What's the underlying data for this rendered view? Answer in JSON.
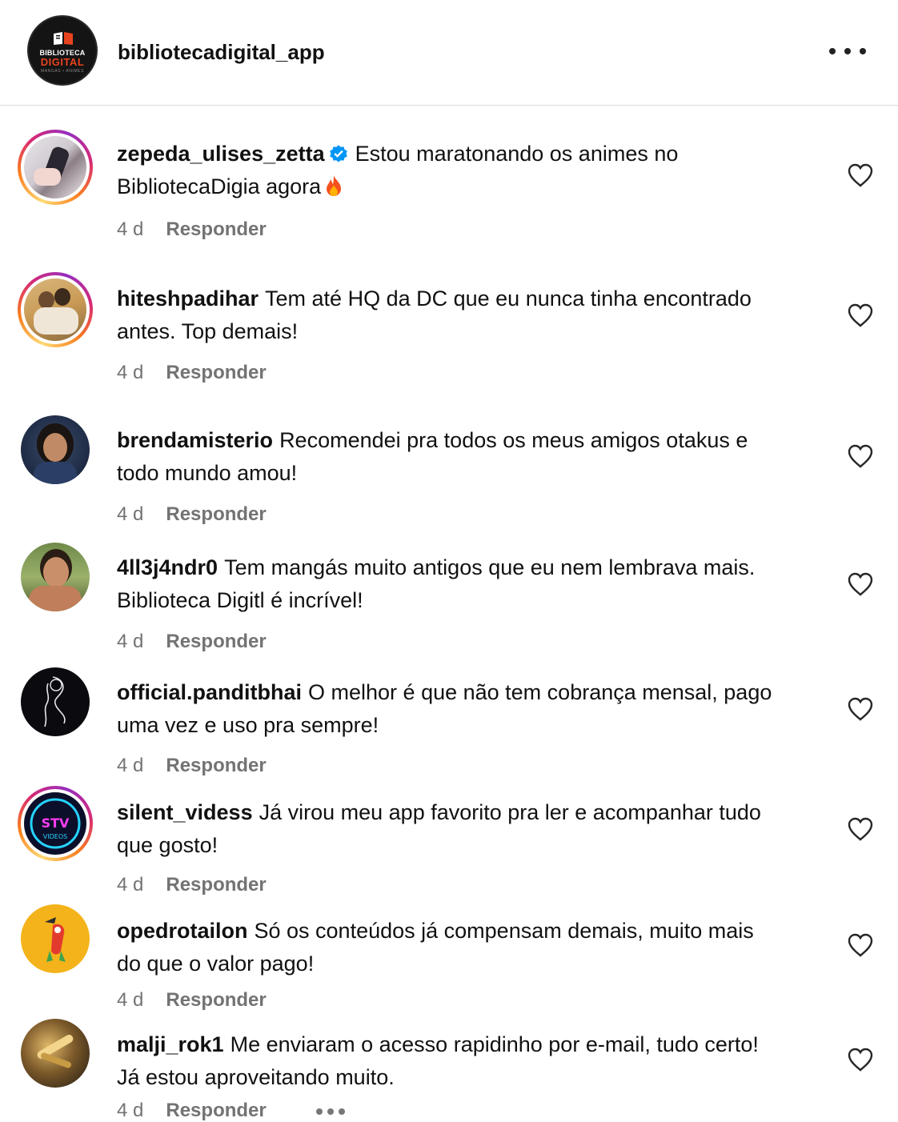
{
  "header": {
    "account_name": "bibliotecadigital_app",
    "logo_line1": "BIBLIOTECA",
    "logo_line2": "DIGITAL",
    "logo_line3": "MANGAS • ANIMES",
    "more_icon": "more-horizontal-icon"
  },
  "comments": [
    {
      "user": "zepeda_ulises_zetta",
      "verified": true,
      "text": "Estou maratonando os animes no BibliotecaDigia agora",
      "emoji": "fire-icon",
      "time": "4 d",
      "reply": "Responder",
      "story_ring": true
    },
    {
      "user": "hiteshpadihar",
      "text": "Tem até HQ da DC que eu nunca tinha encontrado antes. Top demais!",
      "time": "4 d",
      "reply": "Responder",
      "story_ring": true
    },
    {
      "user": "brendamisterio",
      "text": "Recomendei pra todos os meus amigos otakus e todo mundo amou!",
      "time": "4 d",
      "reply": "Responder",
      "story_ring": false
    },
    {
      "user": "4ll3j4ndr0",
      "text": "Tem mangás muito antigos que eu nem lembrava mais. Biblioteca Digitl é incrível!",
      "time": "4 d",
      "reply": "Responder",
      "story_ring": false
    },
    {
      "user": "official.panditbhai",
      "text": "O melhor é que não tem cobrança mensal, pago uma vez e uso pra sempre!",
      "time": "4 d",
      "reply": "Responder",
      "story_ring": false
    },
    {
      "user": "silent_videss",
      "text": "Já virou meu app favorito pra ler e acompanhar tudo que gosto!",
      "time": "4 d",
      "reply": "Responder",
      "story_ring": true
    },
    {
      "user": "opedrotailon",
      "text": "Só os conteúdos já compensam demais, muito mais do que o valor pago!",
      "time": "4 d",
      "reply": "Responder",
      "story_ring": false
    },
    {
      "user": "malji_rok1",
      "text": "Me enviaram o acesso rapidinho por e-mail, tudo certo! Já estou aproveitando muito.",
      "time": "4 d",
      "reply": "Responder",
      "story_ring": false
    }
  ],
  "icons": {
    "like": "heart-outline-icon",
    "verified": "verified-badge-icon",
    "thread_more": "more-horizontal-icon"
  },
  "colors": {
    "verified": "#0095f6",
    "meta_text": "#737373",
    "logo_accent": "#e8431f"
  }
}
